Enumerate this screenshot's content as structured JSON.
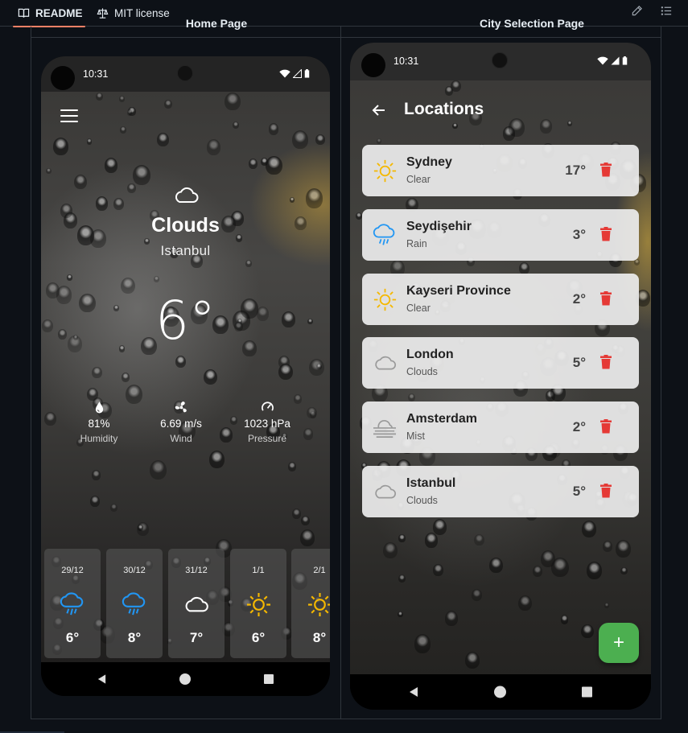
{
  "github": {
    "tabs": [
      {
        "label": "README",
        "icon": "book-icon",
        "active": true
      },
      {
        "label": "MIT license",
        "icon": "scale-icon",
        "active": false
      }
    ],
    "actions": [
      "pencil-icon",
      "list-icon"
    ]
  },
  "table": {
    "headers": [
      "Home Page",
      "City Selection Page"
    ]
  },
  "home": {
    "status_time": "10:31",
    "condition": "Clouds",
    "city": "Istanbul",
    "temperature": "6°",
    "stats": [
      {
        "value": "81%",
        "label": "Humidity",
        "icon": "water-drop-icon"
      },
      {
        "value": "6.69 m/s",
        "label": "Wind",
        "icon": "wind-icon"
      },
      {
        "value": "1023 hPa",
        "label": "Pressure",
        "icon": "gauge-icon"
      }
    ],
    "forecast": [
      {
        "date": "29/12",
        "temp": "6°",
        "icon": "rain-icon"
      },
      {
        "date": "30/12",
        "temp": "8°",
        "icon": "rain-icon"
      },
      {
        "date": "31/12",
        "temp": "7°",
        "icon": "cloud-icon"
      },
      {
        "date": "1/1",
        "temp": "6°",
        "icon": "sun-icon"
      },
      {
        "date": "2/1",
        "temp": "8°",
        "icon": "sun-icon"
      }
    ]
  },
  "locations": {
    "status_time": "10:31",
    "title": "Locations",
    "items": [
      {
        "name": "Sydney",
        "desc": "Clear",
        "temp": "17°",
        "icon": "sun-icon"
      },
      {
        "name": "Seydişehir",
        "desc": "Rain",
        "temp": "3°",
        "icon": "rain-icon"
      },
      {
        "name": "Kayseri Province",
        "desc": "Clear",
        "temp": "2°",
        "icon": "sun-icon"
      },
      {
        "name": "London",
        "desc": "Clouds",
        "temp": "5°",
        "icon": "cloud-icon"
      },
      {
        "name": "Amsterdam",
        "desc": "Mist",
        "temp": "2°",
        "icon": "mist-icon"
      },
      {
        "name": "Istanbul",
        "desc": "Clouds",
        "temp": "5°",
        "icon": "cloud-icon"
      }
    ],
    "fab_label": "+"
  },
  "colors": {
    "sun": "#f5b800",
    "rain": "#2196f3",
    "delete": "#e53935",
    "fab": "#4caf50",
    "tab_underline": "#f78166"
  }
}
